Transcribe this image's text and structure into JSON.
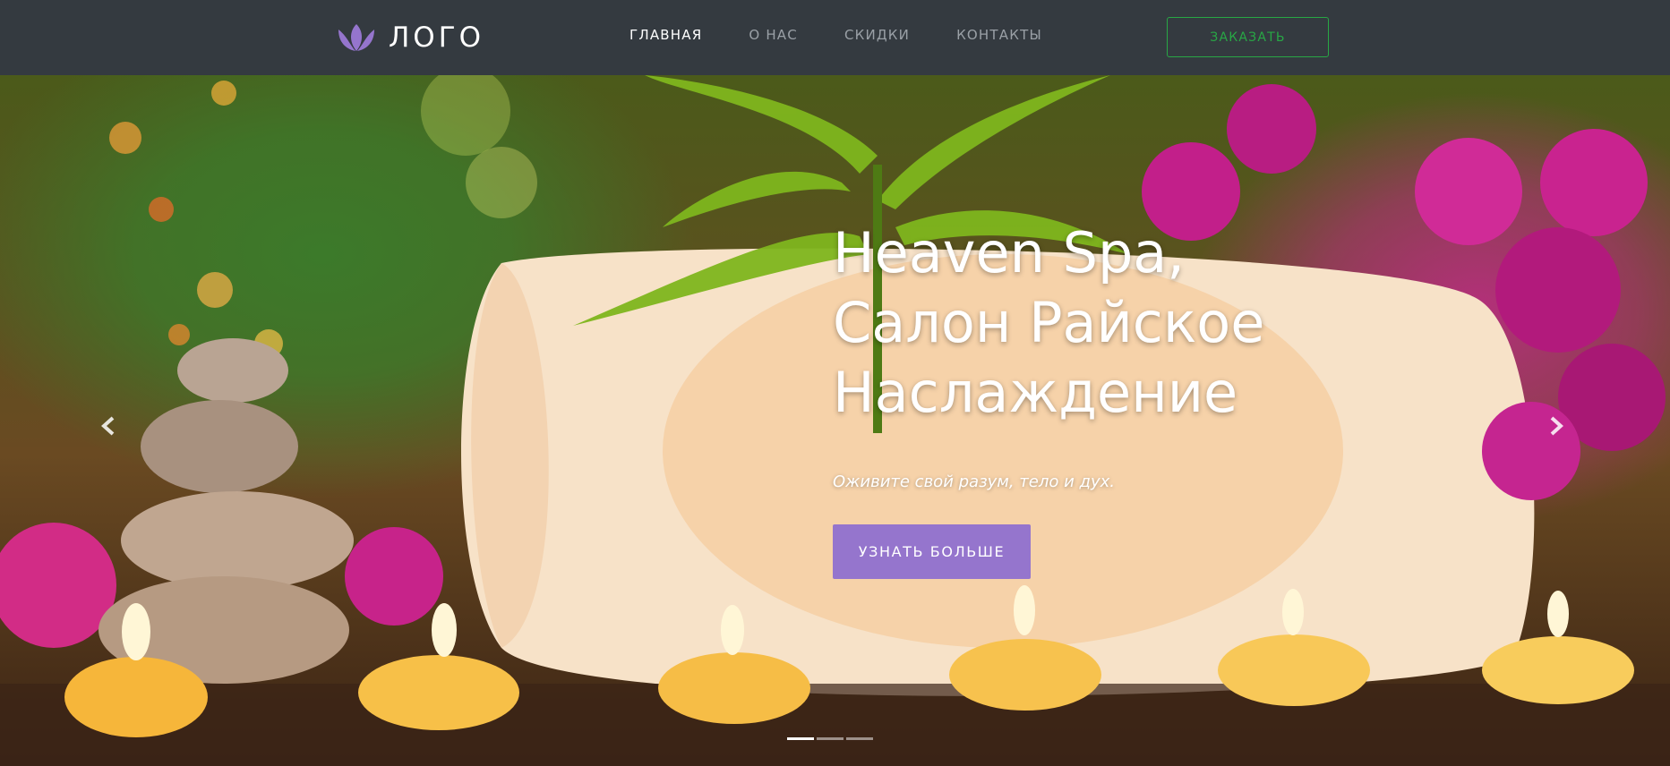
{
  "navbar": {
    "brand_text": "ЛОГО",
    "brand_icon": "lotus-icon",
    "links": [
      {
        "label": "ГЛАВНАЯ",
        "active": true
      },
      {
        "label": "О НАС",
        "active": false
      },
      {
        "label": "СКИДКИ",
        "active": false
      },
      {
        "label": "КОНТАКТЫ",
        "active": false
      }
    ],
    "order_label": "ЗАКАЗАТЬ"
  },
  "hero": {
    "title_line1": "Heaven Spa,",
    "title_line2": "Салон Райское",
    "title_line3": "Наслаждение",
    "subtitle": "Оживите свой разум, тело и дух.",
    "button_label": "УЗНАТЬ БОЛЬШЕ",
    "prev_icon": "chevron-left-icon",
    "next_icon": "chevron-right-icon",
    "indicators": [
      true,
      false,
      false
    ]
  },
  "colors": {
    "navbar_bg": "#343a40",
    "accent_purple": "#9575cd",
    "order_green": "#28a745"
  }
}
